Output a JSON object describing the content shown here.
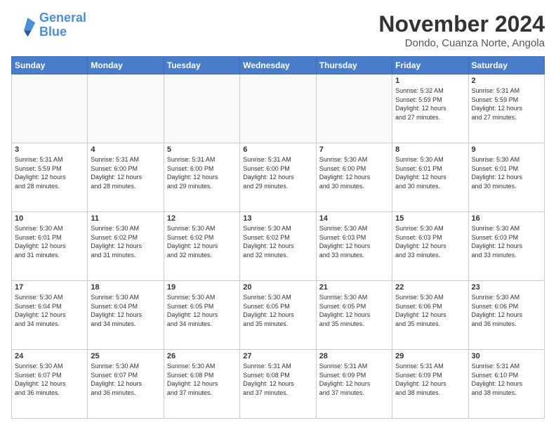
{
  "header": {
    "logo_line1": "General",
    "logo_line2": "Blue",
    "title": "November 2024",
    "subtitle": "Dondo, Cuanza Norte, Angola"
  },
  "calendar": {
    "days_of_week": [
      "Sunday",
      "Monday",
      "Tuesday",
      "Wednesday",
      "Thursday",
      "Friday",
      "Saturday"
    ],
    "weeks": [
      [
        {
          "day": "",
          "info": ""
        },
        {
          "day": "",
          "info": ""
        },
        {
          "day": "",
          "info": ""
        },
        {
          "day": "",
          "info": ""
        },
        {
          "day": "",
          "info": ""
        },
        {
          "day": "1",
          "info": "Sunrise: 5:32 AM\nSunset: 5:59 PM\nDaylight: 12 hours\nand 27 minutes."
        },
        {
          "day": "2",
          "info": "Sunrise: 5:31 AM\nSunset: 5:59 PM\nDaylight: 12 hours\nand 27 minutes."
        }
      ],
      [
        {
          "day": "3",
          "info": "Sunrise: 5:31 AM\nSunset: 5:59 PM\nDaylight: 12 hours\nand 28 minutes."
        },
        {
          "day": "4",
          "info": "Sunrise: 5:31 AM\nSunset: 6:00 PM\nDaylight: 12 hours\nand 28 minutes."
        },
        {
          "day": "5",
          "info": "Sunrise: 5:31 AM\nSunset: 6:00 PM\nDaylight: 12 hours\nand 29 minutes."
        },
        {
          "day": "6",
          "info": "Sunrise: 5:31 AM\nSunset: 6:00 PM\nDaylight: 12 hours\nand 29 minutes."
        },
        {
          "day": "7",
          "info": "Sunrise: 5:30 AM\nSunset: 6:00 PM\nDaylight: 12 hours\nand 30 minutes."
        },
        {
          "day": "8",
          "info": "Sunrise: 5:30 AM\nSunset: 6:01 PM\nDaylight: 12 hours\nand 30 minutes."
        },
        {
          "day": "9",
          "info": "Sunrise: 5:30 AM\nSunset: 6:01 PM\nDaylight: 12 hours\nand 30 minutes."
        }
      ],
      [
        {
          "day": "10",
          "info": "Sunrise: 5:30 AM\nSunset: 6:01 PM\nDaylight: 12 hours\nand 31 minutes."
        },
        {
          "day": "11",
          "info": "Sunrise: 5:30 AM\nSunset: 6:02 PM\nDaylight: 12 hours\nand 31 minutes."
        },
        {
          "day": "12",
          "info": "Sunrise: 5:30 AM\nSunset: 6:02 PM\nDaylight: 12 hours\nand 32 minutes."
        },
        {
          "day": "13",
          "info": "Sunrise: 5:30 AM\nSunset: 6:02 PM\nDaylight: 12 hours\nand 32 minutes."
        },
        {
          "day": "14",
          "info": "Sunrise: 5:30 AM\nSunset: 6:03 PM\nDaylight: 12 hours\nand 33 minutes."
        },
        {
          "day": "15",
          "info": "Sunrise: 5:30 AM\nSunset: 6:03 PM\nDaylight: 12 hours\nand 33 minutes."
        },
        {
          "day": "16",
          "info": "Sunrise: 5:30 AM\nSunset: 6:03 PM\nDaylight: 12 hours\nand 33 minutes."
        }
      ],
      [
        {
          "day": "17",
          "info": "Sunrise: 5:30 AM\nSunset: 6:04 PM\nDaylight: 12 hours\nand 34 minutes."
        },
        {
          "day": "18",
          "info": "Sunrise: 5:30 AM\nSunset: 6:04 PM\nDaylight: 12 hours\nand 34 minutes."
        },
        {
          "day": "19",
          "info": "Sunrise: 5:30 AM\nSunset: 6:05 PM\nDaylight: 12 hours\nand 34 minutes."
        },
        {
          "day": "20",
          "info": "Sunrise: 5:30 AM\nSunset: 6:05 PM\nDaylight: 12 hours\nand 35 minutes."
        },
        {
          "day": "21",
          "info": "Sunrise: 5:30 AM\nSunset: 6:05 PM\nDaylight: 12 hours\nand 35 minutes."
        },
        {
          "day": "22",
          "info": "Sunrise: 5:30 AM\nSunset: 6:06 PM\nDaylight: 12 hours\nand 35 minutes."
        },
        {
          "day": "23",
          "info": "Sunrise: 5:30 AM\nSunset: 6:06 PM\nDaylight: 12 hours\nand 36 minutes."
        }
      ],
      [
        {
          "day": "24",
          "info": "Sunrise: 5:30 AM\nSunset: 6:07 PM\nDaylight: 12 hours\nand 36 minutes."
        },
        {
          "day": "25",
          "info": "Sunrise: 5:30 AM\nSunset: 6:07 PM\nDaylight: 12 hours\nand 36 minutes."
        },
        {
          "day": "26",
          "info": "Sunrise: 5:30 AM\nSunset: 6:08 PM\nDaylight: 12 hours\nand 37 minutes."
        },
        {
          "day": "27",
          "info": "Sunrise: 5:31 AM\nSunset: 6:08 PM\nDaylight: 12 hours\nand 37 minutes."
        },
        {
          "day": "28",
          "info": "Sunrise: 5:31 AM\nSunset: 6:09 PM\nDaylight: 12 hours\nand 37 minutes."
        },
        {
          "day": "29",
          "info": "Sunrise: 5:31 AM\nSunset: 6:09 PM\nDaylight: 12 hours\nand 38 minutes."
        },
        {
          "day": "30",
          "info": "Sunrise: 5:31 AM\nSunset: 6:10 PM\nDaylight: 12 hours\nand 38 minutes."
        }
      ]
    ]
  }
}
